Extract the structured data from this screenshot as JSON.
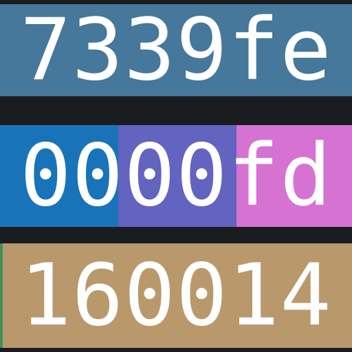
{
  "rows": [
    {
      "label": "7339fe",
      "segments": [
        {
          "text": "7339fe",
          "color": "#45789a"
        }
      ]
    },
    {
      "label": "0000fd",
      "segments": [
        {
          "text": "00",
          "color": "#1873b8"
        },
        {
          "text": "00",
          "color": "#6363c0"
        },
        {
          "text": "fd",
          "color": "#d672d2"
        }
      ]
    },
    {
      "label": "160014",
      "segments": [
        {
          "text": "160014",
          "color": "#b9996b"
        }
      ],
      "edge_color": "#3f8f5a"
    }
  ],
  "background": "#1b1c20"
}
